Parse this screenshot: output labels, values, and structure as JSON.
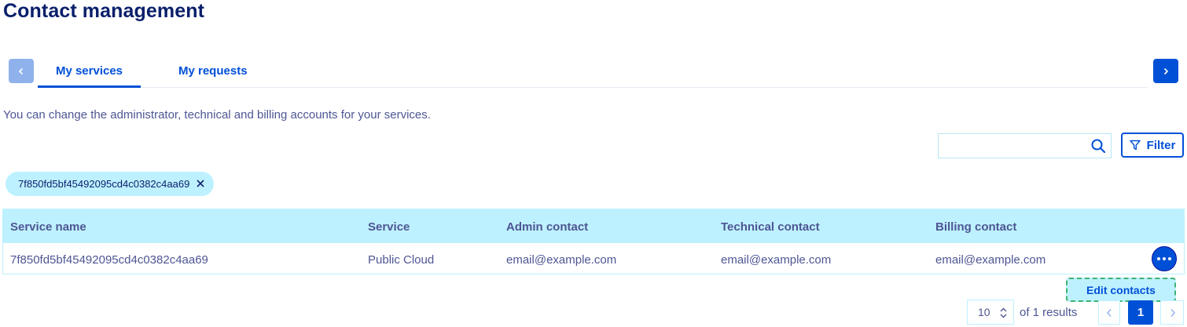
{
  "page": {
    "title": "Contact management",
    "intro": "You can change the administrator, technical and billing accounts for your services."
  },
  "tabs": [
    {
      "label": "My services",
      "active": true
    },
    {
      "label": "My requests",
      "active": false
    }
  ],
  "search": {
    "value": "",
    "placeholder": ""
  },
  "filter": {
    "label": "Filter"
  },
  "active_filter_chip": {
    "label": "7f850fd5bf45492095cd4c0382c4aa69"
  },
  "table": {
    "columns": [
      "Service name",
      "Service",
      "Admin contact",
      "Technical contact",
      "Billing contact"
    ],
    "rows": [
      [
        "7f850fd5bf45492095cd4c0382c4aa69",
        "Public Cloud",
        "email@example.com",
        "email@example.com",
        "email@example.com"
      ]
    ]
  },
  "row_menu": {
    "items": [
      "Edit contacts"
    ]
  },
  "pagination": {
    "page_size": "10",
    "summary": "of 1 results",
    "current_page": "1"
  },
  "colors": {
    "accent": "#0050d7",
    "header_bg": "#bef1ff",
    "title": "#0a1f6b",
    "text": "#4d5693"
  },
  "icons": [
    "chevron-left-icon",
    "chevron-right-icon",
    "search-icon",
    "filter-icon",
    "close-icon",
    "more-icon",
    "sort-icon"
  ]
}
